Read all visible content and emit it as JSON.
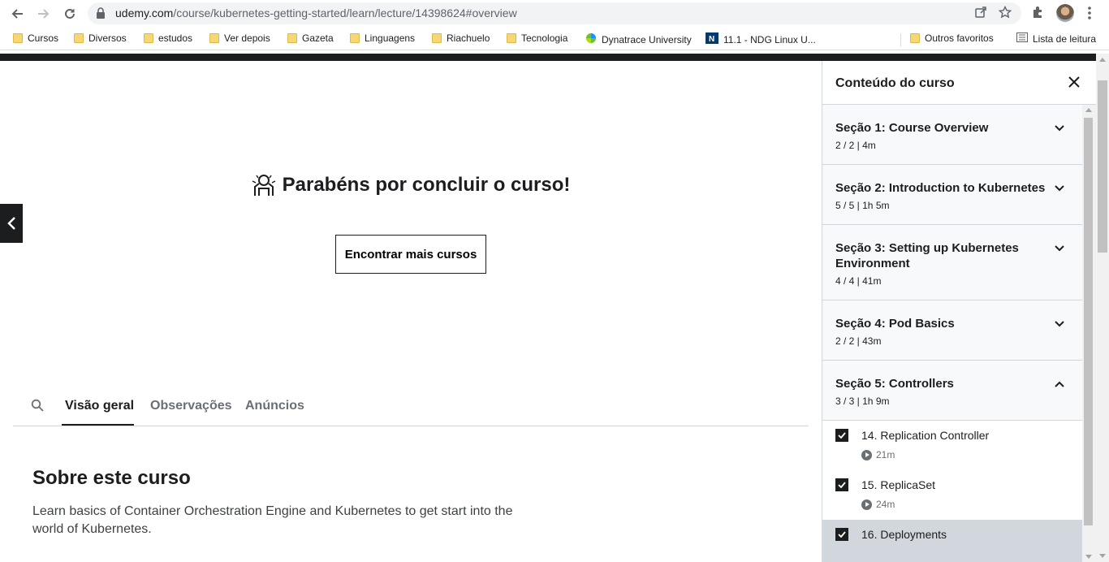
{
  "browser": {
    "url_domain": "udemy.com",
    "url_path": "/course/kubernetes-getting-started/learn/lecture/14398624#overview"
  },
  "bookmarks": [
    {
      "label": "Cursos",
      "icon": "folder-icon"
    },
    {
      "label": "Diversos",
      "icon": "folder-icon"
    },
    {
      "label": "estudos",
      "icon": "folder-icon"
    },
    {
      "label": "Ver depois",
      "icon": "folder-icon"
    },
    {
      "label": "Gazeta",
      "icon": "folder-icon"
    },
    {
      "label": "Linguagens",
      "icon": "folder-icon"
    },
    {
      "label": "Riachuelo",
      "icon": "folder-icon"
    },
    {
      "label": "Tecnologia",
      "icon": "folder-icon"
    },
    {
      "label": "Dynatrace University",
      "icon": "dynatrace-icon"
    },
    {
      "label": "11.1 - NDG Linux U...",
      "icon": "ndg-icon"
    }
  ],
  "bookmarks_right": {
    "other_favorites": "Outros favoritos",
    "reading_list": "Lista de leitura"
  },
  "main": {
    "congrats_text": "Parabéns por concluir o curso!",
    "find_more_button": "Encontrar mais cursos",
    "tabs": [
      {
        "label": "Visão geral",
        "active": true
      },
      {
        "label": "Observações",
        "active": false
      },
      {
        "label": "Anúncios",
        "active": false
      }
    ],
    "about_title": "Sobre este curso",
    "about_text": "Learn basics of Container Orchestration Engine and Kubernetes to get start into the world of Kubernetes."
  },
  "sidebar": {
    "title": "Conteúdo do curso",
    "sections": [
      {
        "title": "Seção 1: Course Overview",
        "meta": "2 / 2 | 4m",
        "expanded": false
      },
      {
        "title": "Seção 2: Introduction to Kubernetes",
        "meta": "5 / 5 | 1h 5m",
        "expanded": false
      },
      {
        "title": "Seção 3: Setting up Kubernetes Environment",
        "meta": "4 / 4 | 41m",
        "expanded": false
      },
      {
        "title": "Seção 4: Pod Basics",
        "meta": "2 / 2 | 43m",
        "expanded": false
      },
      {
        "title": "Seção 5: Controllers",
        "meta": "3 / 3 | 1h 9m",
        "expanded": true
      }
    ],
    "lessons": [
      {
        "title": "14. Replication Controller",
        "duration": "21m",
        "checked": true
      },
      {
        "title": "15. ReplicaSet",
        "duration": "24m",
        "checked": true
      },
      {
        "title": "16. Deployments",
        "duration": "",
        "checked": true,
        "current": true
      }
    ]
  },
  "colors": {
    "dark": "#1c1d1f",
    "section_bg": "#f7f9fa",
    "border": "#d1d7dc"
  }
}
